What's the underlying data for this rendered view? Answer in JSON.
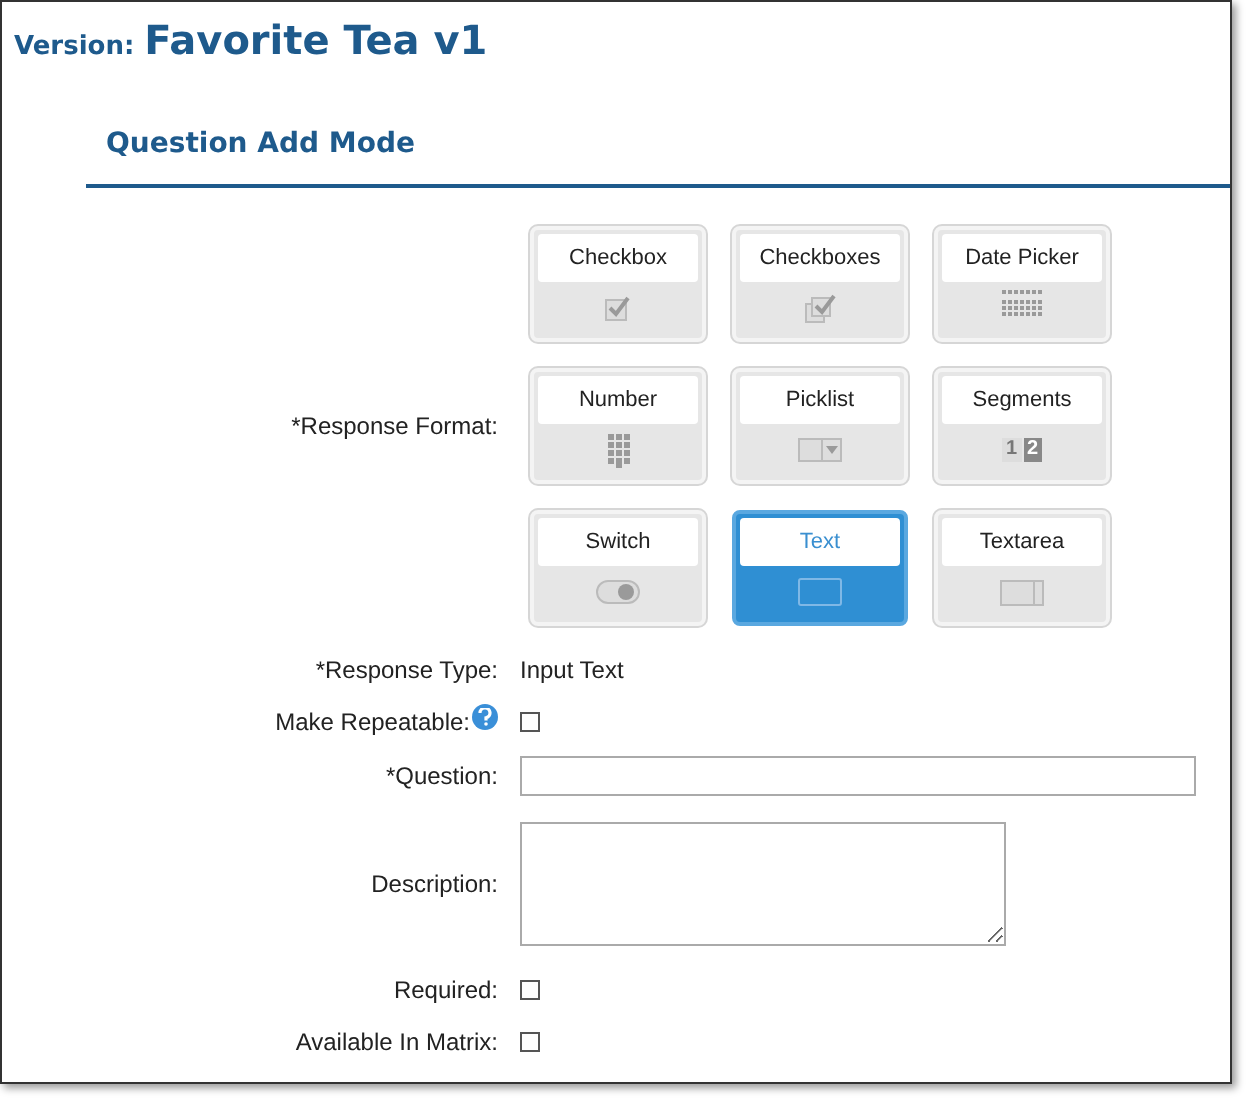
{
  "version": {
    "label": "Version:",
    "title": "Favorite Tea v1"
  },
  "section_title": "Question Add Mode",
  "response_format": {
    "label": "*Response Format:",
    "options": [
      {
        "label": "Checkbox",
        "kind": "checkbox",
        "selected": false
      },
      {
        "label": "Checkboxes",
        "kind": "checkboxes",
        "selected": false
      },
      {
        "label": "Date Picker",
        "kind": "date",
        "selected": false
      },
      {
        "label": "Number",
        "kind": "number",
        "selected": false
      },
      {
        "label": "Picklist",
        "kind": "picklist",
        "selected": false
      },
      {
        "label": "Segments",
        "kind": "segments",
        "selected": false,
        "digits": [
          "1",
          "2"
        ]
      },
      {
        "label": "Switch",
        "kind": "switch",
        "selected": false
      },
      {
        "label": "Text",
        "kind": "text",
        "selected": true
      },
      {
        "label": "Textarea",
        "kind": "textarea",
        "selected": false
      }
    ]
  },
  "fields": [
    {
      "kind": "text",
      "label": "*Response Type:",
      "value": "Input Text"
    },
    {
      "kind": "checkbox",
      "label": "Make Repeatable:",
      "help": true,
      "checked": false
    },
    {
      "kind": "input",
      "label": "*Question:"
    },
    {
      "kind": "textarea",
      "label": "Description:"
    },
    {
      "kind": "checkbox",
      "label": "Required:",
      "checked": false
    },
    {
      "kind": "checkbox",
      "label": "Available In Matrix:",
      "checked": false
    }
  ]
}
